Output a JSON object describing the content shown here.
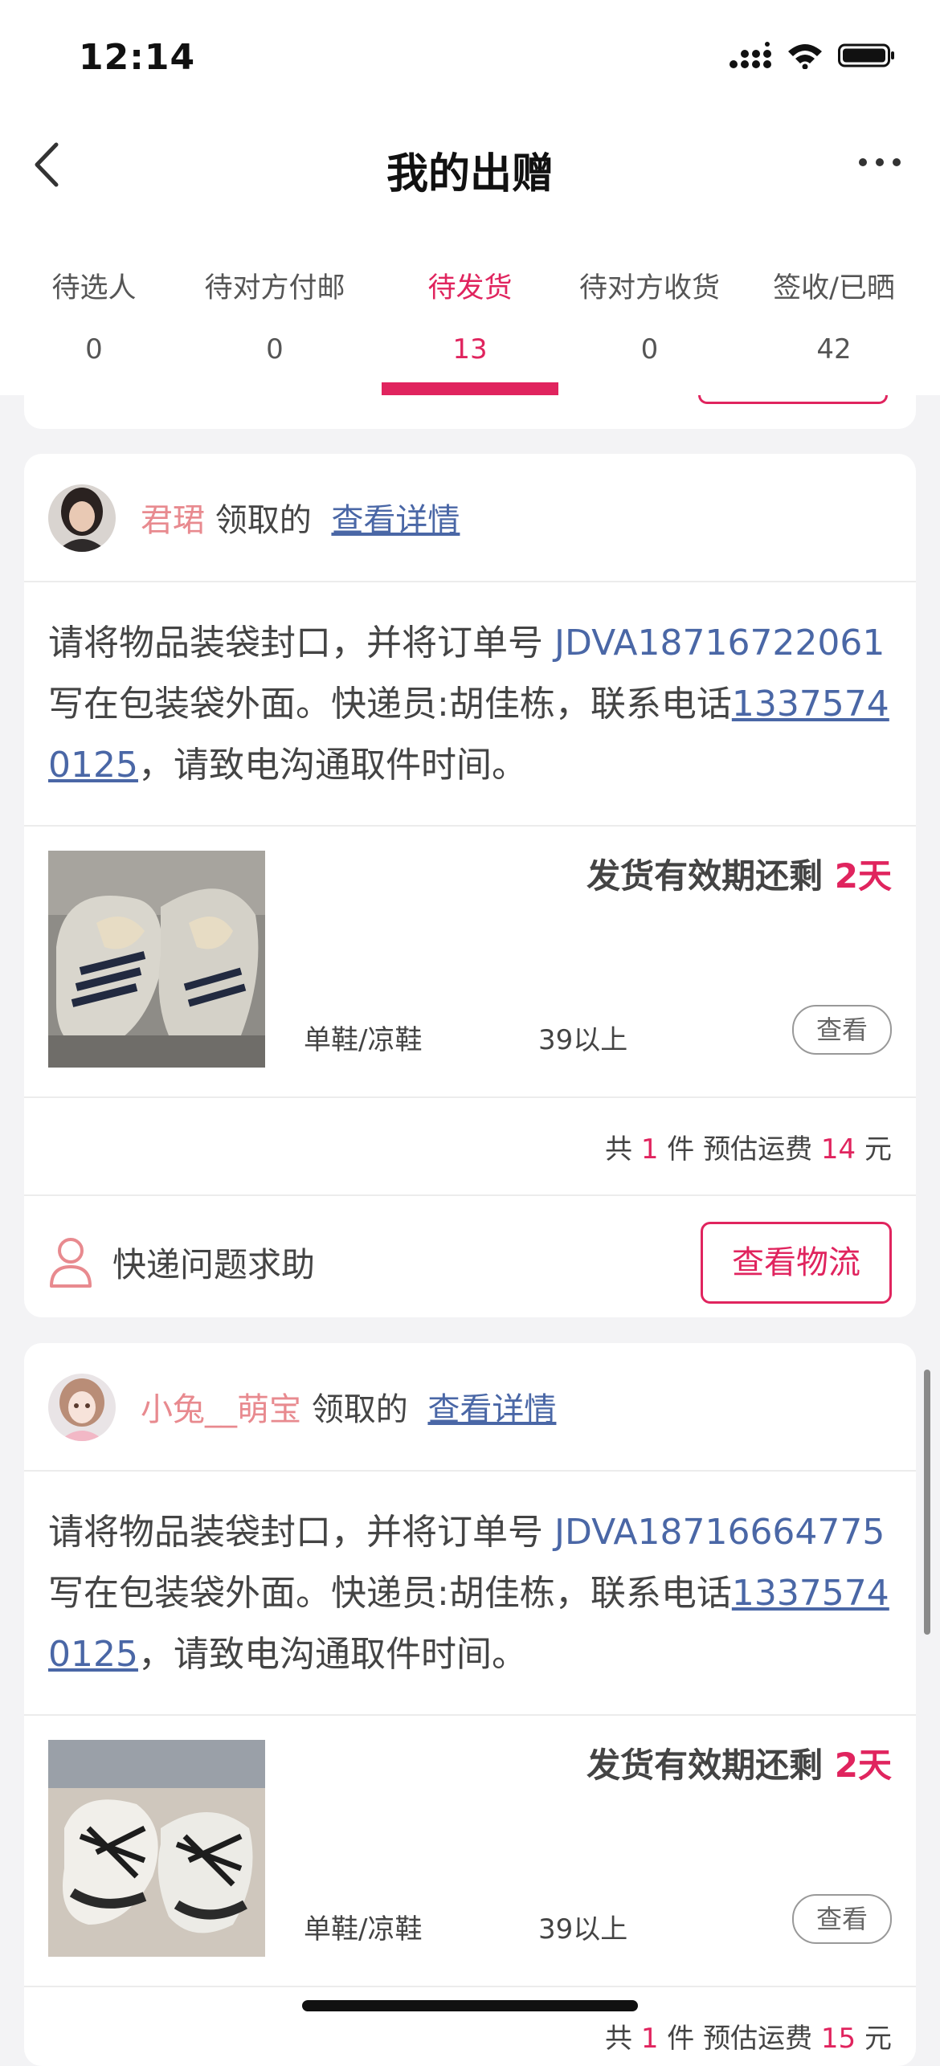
{
  "status_bar": {
    "time": "12:14"
  },
  "nav": {
    "title": "我的出赠"
  },
  "tabs": [
    {
      "label": "待选人",
      "count": "0"
    },
    {
      "label": "待对方付邮",
      "count": "0"
    },
    {
      "label": "待发货",
      "count": "13",
      "active": true
    },
    {
      "label": "待对方收货",
      "count": "0"
    },
    {
      "label": "签收/已晒",
      "count": "42"
    }
  ],
  "orders": [
    {
      "recipient": "君珺",
      "received_text": "领取的",
      "detail_link": "查看详情",
      "instr_prefix": "请将物品装袋封口，并将订单号 ",
      "order_no": "JDVA18716722061",
      "instr_mid": " 写在包装袋外面。快递员:胡佳栋，联系电话",
      "phone": "13375740125",
      "instr_suffix": "，请致电沟通取件时间。",
      "deadline_label": "发货有效期还剩 ",
      "deadline_days": "2天",
      "category": "单鞋/凉鞋",
      "size": "39以上",
      "view_label": "查看",
      "sum_prefix": "共 ",
      "qty": "1",
      "sum_mid": " 件 预估运费 ",
      "fee": "14",
      "sum_suffix": " 元",
      "help_label": "快递问题求助",
      "logistics_label": "查看物流"
    },
    {
      "recipient": "小兔__萌宝",
      "received_text": "领取的",
      "detail_link": "查看详情",
      "instr_prefix": "请将物品装袋封口，并将订单号 ",
      "order_no": "JDVA18716664775",
      "instr_mid": " 写在包装袋外面。快递员:胡佳栋，联系电话",
      "phone": "13375740125",
      "instr_suffix": "，请致电沟通取件时间。",
      "deadline_label": "发货有效期还剩 ",
      "deadline_days": "2天",
      "category": "单鞋/凉鞋",
      "size": "39以上",
      "view_label": "查看",
      "sum_prefix": "共 ",
      "qty": "1",
      "sum_mid": " 件 预估运费 ",
      "fee": "15",
      "sum_suffix": " 元"
    }
  ],
  "colors": {
    "accent": "#e0245e",
    "link": "#4a67a6",
    "name": "#e88a8f"
  }
}
